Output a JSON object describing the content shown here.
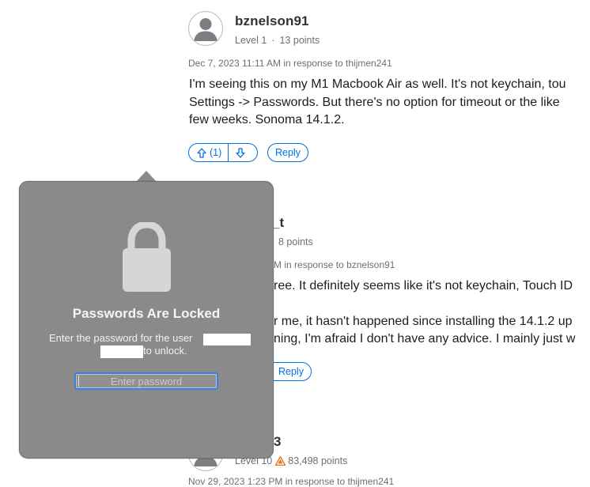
{
  "posts": [
    {
      "username": "bznelson91",
      "level": "Level 1",
      "points": "13 points",
      "date": "Dec 7, 2023 11:11 AM",
      "in_response_to_label": "in response to",
      "in_response_to_user": "thijmen241",
      "body_lines": [
        "I'm seeing this on my M1 Macbook Air as well. It's not keychain, tou",
        "Settings -> Passwords. But there's no option for timeout or the like",
        "few weeks. Sonoma 14.1.2."
      ],
      "vote_count": "(1)",
      "reply_label": "Reply"
    },
    {
      "username_partial": "_t",
      "points": "8 points",
      "date_partial": "M",
      "in_response_to_label": "in response to",
      "in_response_to_user": "bznelson91",
      "body_lines": [
        "ree. It definitely seems like it's not keychain, Touch ID",
        "r me, it hasn't happened since installing the 14.1.2 up",
        "ning, I'm afraid I don't have any advice. I mainly just w"
      ],
      "reply_label": "Reply"
    },
    {
      "username_partial": "3",
      "level": "Level 10",
      "points": "83,498 points",
      "date_partial": "Nov 29, 2023 1:23 PM in response to thijmen241"
    }
  ],
  "popover": {
    "title": "Passwords Are Locked",
    "message_part1": "Enter the password for the user",
    "message_part2": "to unlock.",
    "password_placeholder": "Enter password"
  },
  "colors": {
    "accent": "#0071e3",
    "popover_bg": "#8a8a8a",
    "level10_badge": "#e8731f"
  }
}
